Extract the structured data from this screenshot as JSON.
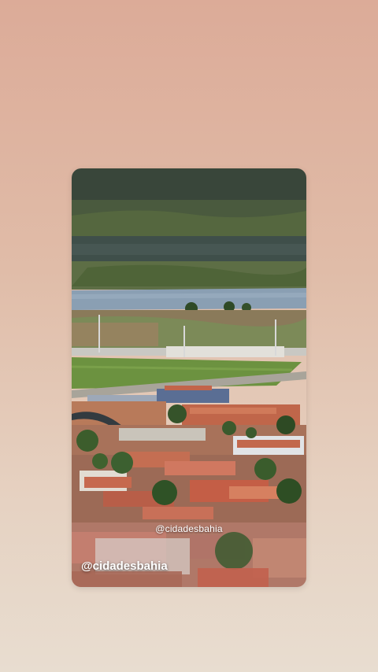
{
  "background": {
    "gradient_top": "#dcab98",
    "gradient_bottom": "#e8ddd0"
  },
  "story": {
    "image_subject": "aerial-town-photo",
    "watermark_center": "@cidadesbahia",
    "watermark_bottom": "@cidadesbahia"
  },
  "colors": {
    "hills": "#3d4a36",
    "river": "#8da2b8",
    "pitch": "#6b8f3f",
    "roofs": "#b8604a"
  }
}
